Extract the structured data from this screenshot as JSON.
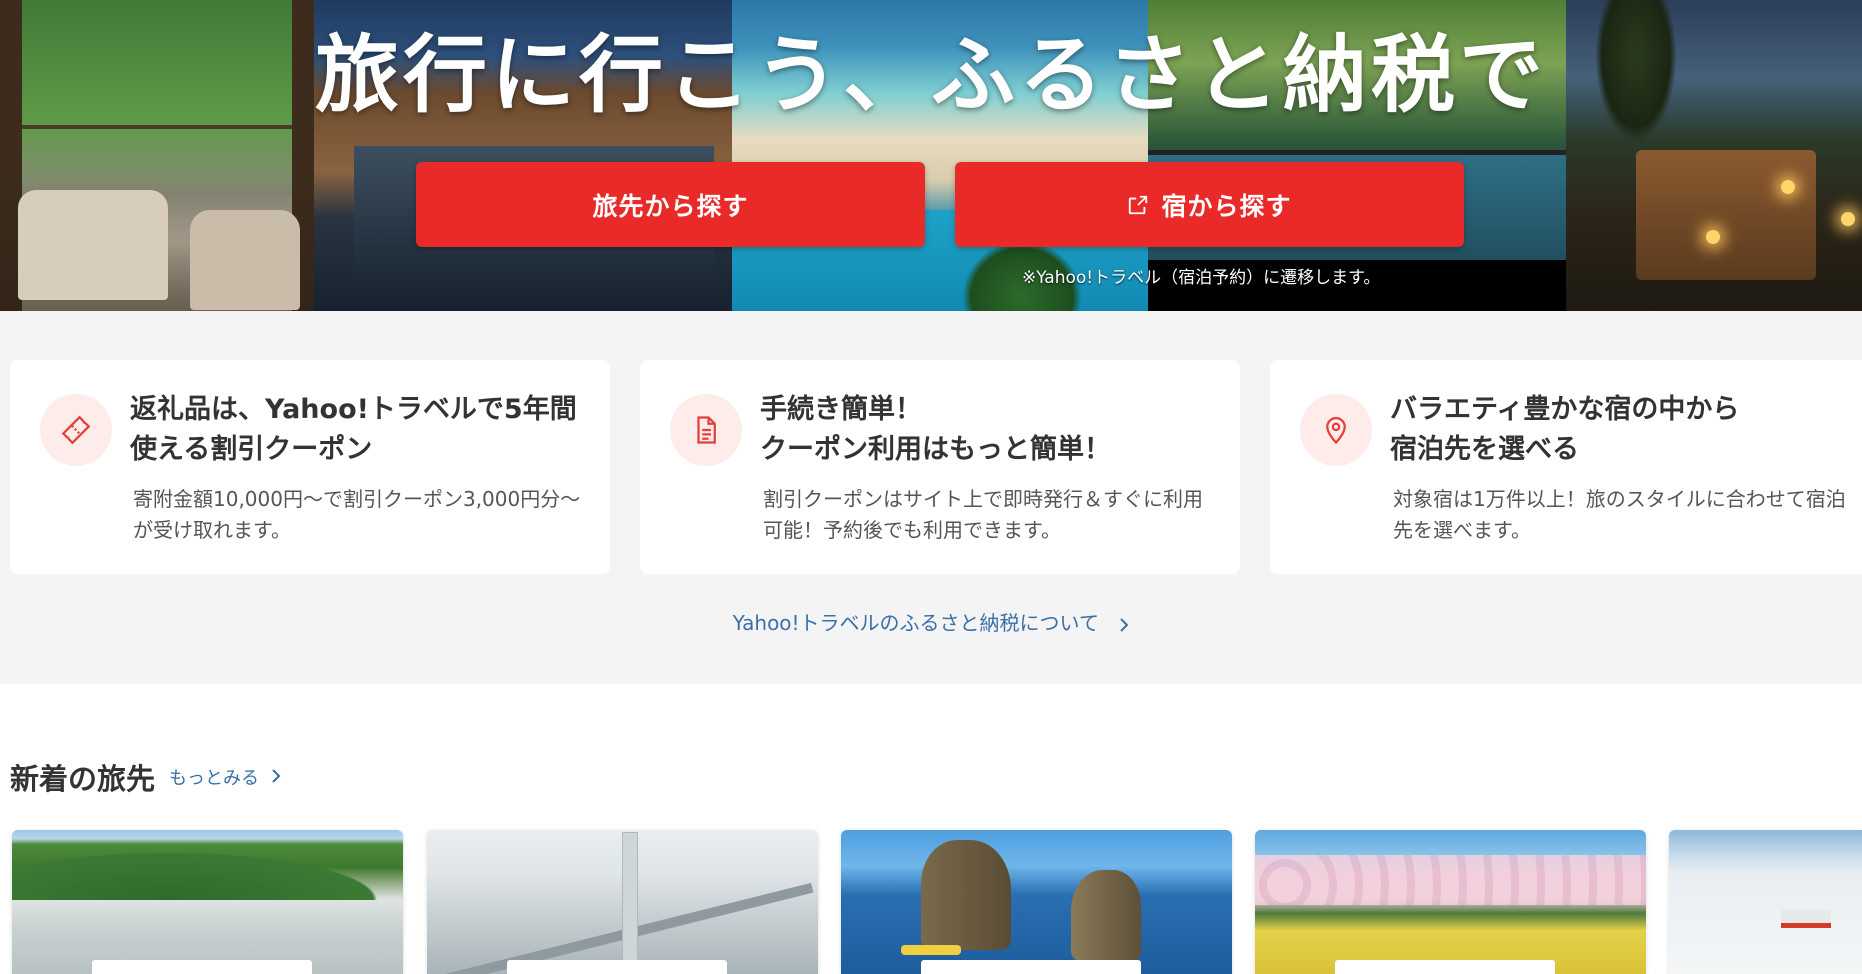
{
  "hero": {
    "title": "旅行に行こう、ふるさと納税で",
    "buttons": {
      "destination": "旅先から探す",
      "inn": "宿から探す"
    },
    "note": "※Yahoo!トラベル（宿泊予約）に遷移します。"
  },
  "features": [
    {
      "title": "返礼品は、Yahoo!トラベルで5年間\n使える割引クーポン",
      "desc": "寄附金額10,000円〜で割引クーポン3,000円分〜が受け取れます。",
      "icon": "ticket-icon"
    },
    {
      "title": "手続き簡単！\nクーポン利用はもっと簡単！",
      "desc": "割引クーポンはサイト上で即時発行＆すぐに利用可能！予約後でも利用できます。",
      "icon": "document-icon"
    },
    {
      "title": "バラエティ豊かな宿の中から\n宿泊先を選べる",
      "desc": "対象宿は1万件以上！旅のスタイルに合わせて宿泊先を選べます。",
      "icon": "map-pin-icon"
    }
  ],
  "about_link": "Yahoo!トラベルのふるさと納税について",
  "new_destinations": {
    "title": "新着の旅先",
    "more": "もっとみる"
  },
  "colors": {
    "accent_red": "#ea2a28",
    "link_blue": "#3a6fa8",
    "icon_bg": "#fdecea",
    "section_bg": "#f4f4f4"
  }
}
